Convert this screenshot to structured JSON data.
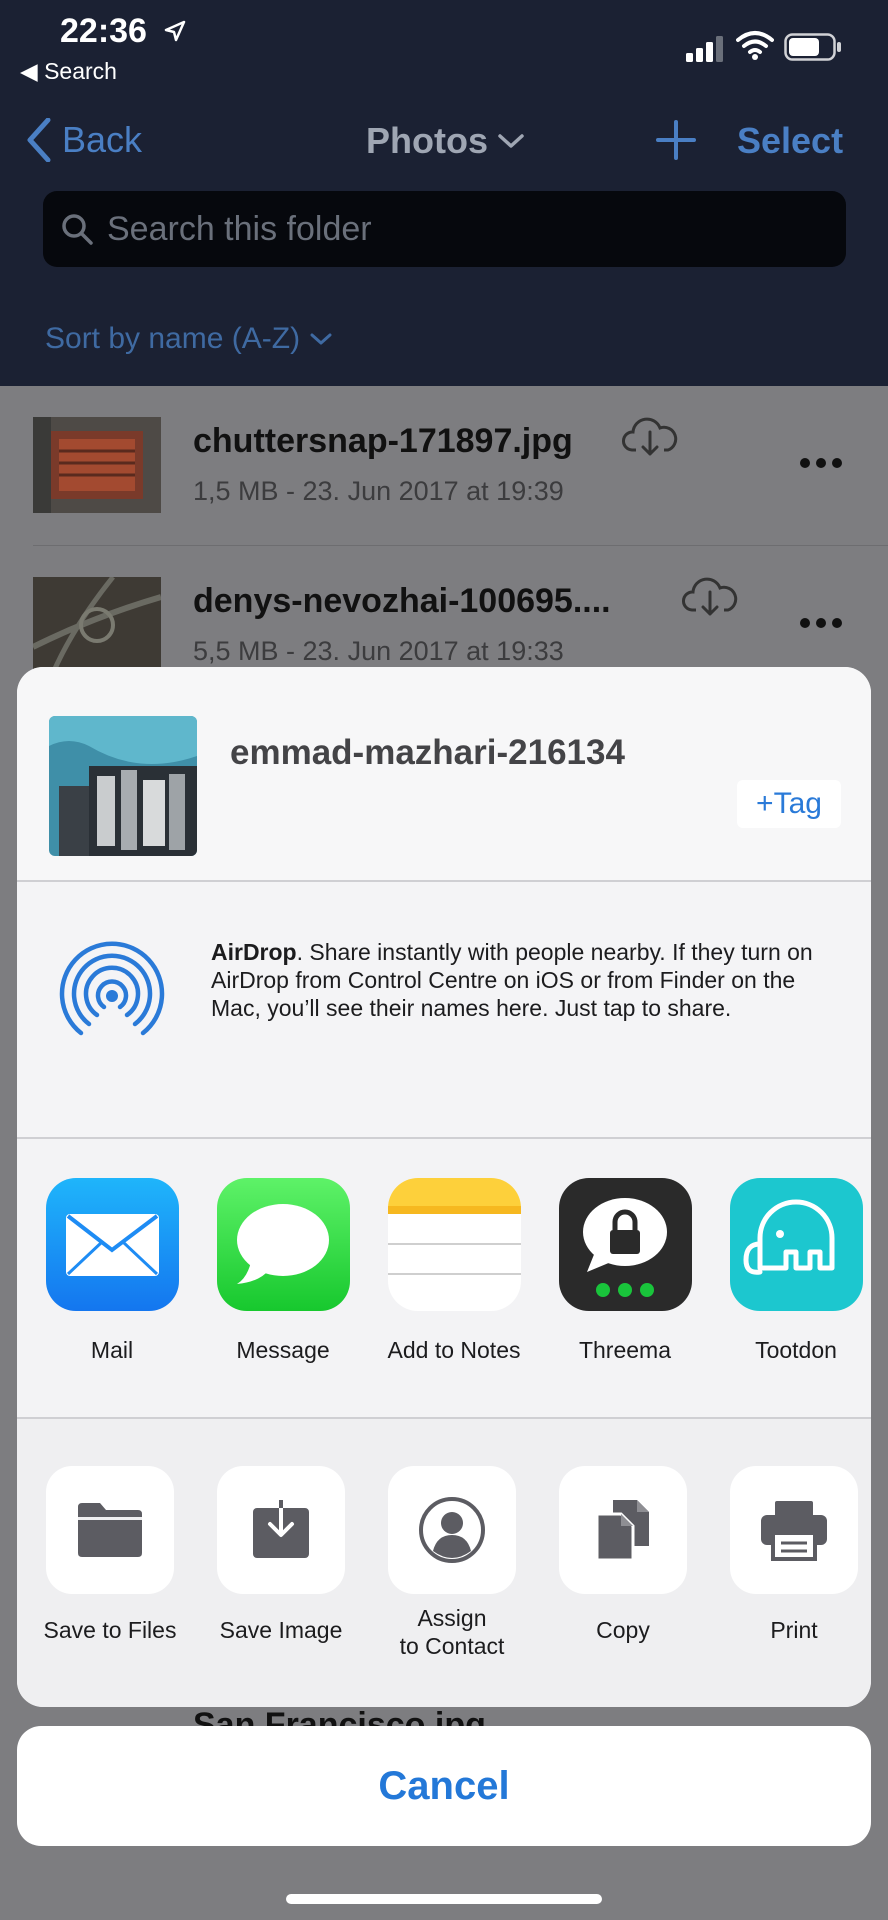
{
  "status_bar": {
    "time": "22:36",
    "back_app": "Search",
    "icons": [
      "location-arrow-icon",
      "signal-icon",
      "wifi-icon",
      "battery-icon"
    ]
  },
  "nav": {
    "back_label": "Back",
    "title": "Photos",
    "select_label": "Select",
    "plus_icon": "plus-icon"
  },
  "search": {
    "placeholder": "Search this folder"
  },
  "sort": {
    "label": "Sort by name (A-Z)"
  },
  "files": [
    {
      "name": "chuttersnap-171897.jpg",
      "meta": "1,5 MB - 23. Jun 2017 at 19:39"
    },
    {
      "name": "denys-nevozhai-100695....",
      "meta": "5,5 MB - 23. Jun 2017 at 19:33"
    }
  ],
  "peek_file": {
    "name": "San Francisco.jpg"
  },
  "share_sheet": {
    "file_title": "emmad-mazhari-216134",
    "tag_label": "+Tag",
    "airdrop": {
      "title": "AirDrop",
      "body": ". Share instantly with people nearby. If they turn on AirDrop from Control Centre on iOS or from Finder on the Mac, you’ll see their names here. Just tap to share."
    },
    "apps": [
      {
        "label": "Mail",
        "icon": "mail-icon"
      },
      {
        "label": "Message",
        "icon": "message-icon"
      },
      {
        "label": "Add to Notes",
        "icon": "notes-icon"
      },
      {
        "label": "Threema",
        "icon": "threema-icon"
      },
      {
        "label": "Tootdon",
        "icon": "tootdon-icon"
      }
    ],
    "actions": [
      {
        "label": "Save to Files",
        "icon": "folder-icon"
      },
      {
        "label": "Save Image",
        "icon": "save-image-icon"
      },
      {
        "label_line1": "Assign",
        "label_line2": "to Contact",
        "icon": "contact-icon"
      },
      {
        "label": "Copy",
        "icon": "copy-icon"
      },
      {
        "label": "Print",
        "icon": "printer-icon"
      }
    ],
    "cancel_label": "Cancel"
  },
  "colors": {
    "accent_blue": "#2378d8",
    "nav_blue": "#4a7fc4",
    "dark_bg": "#1b2133"
  }
}
